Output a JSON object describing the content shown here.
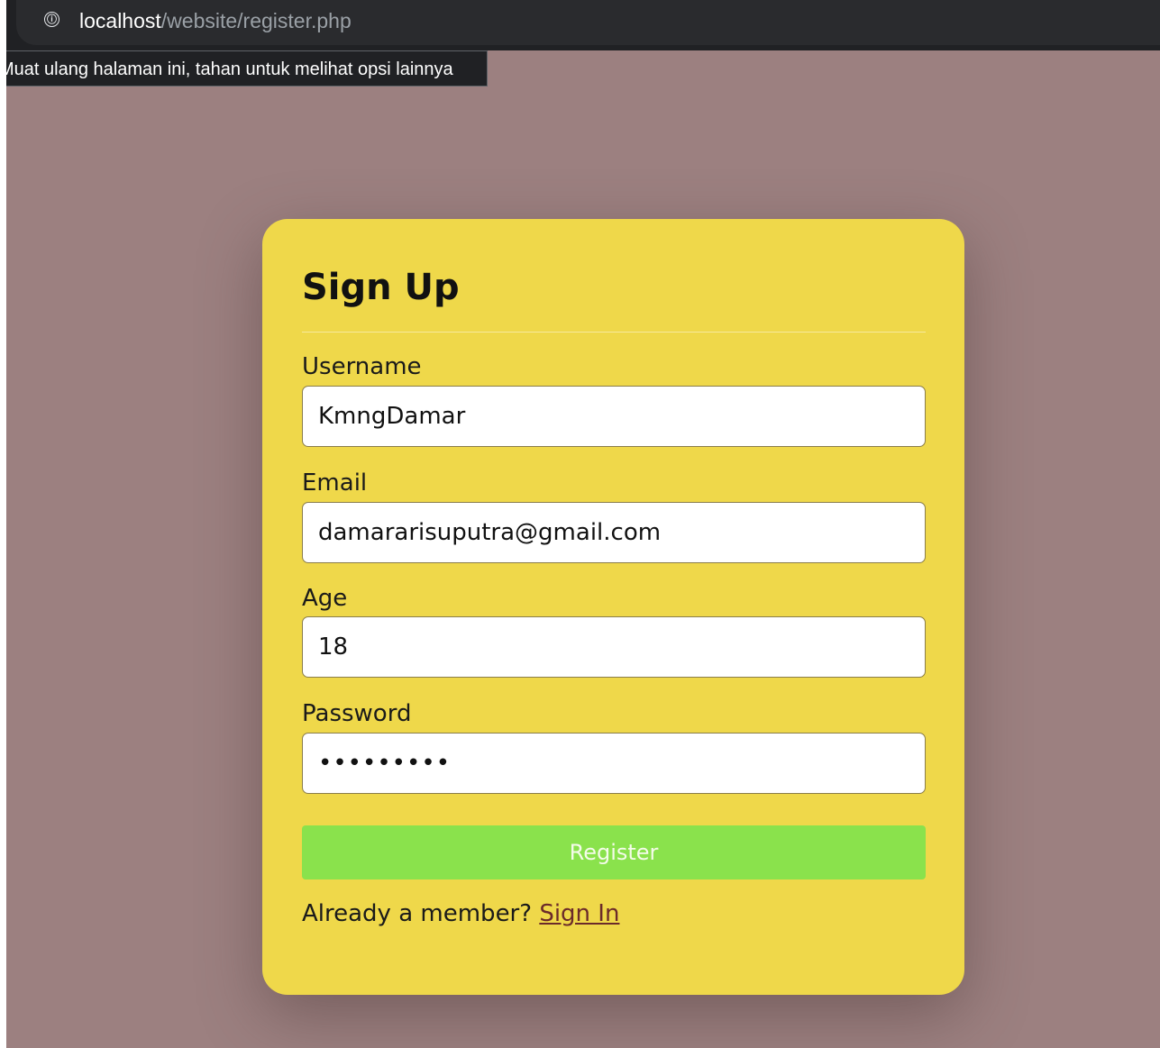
{
  "browser": {
    "url_host": "localhost",
    "url_path": "/website/register.php",
    "reload_tooltip": "Muat ulang halaman ini, tahan untuk melihat opsi lainnya",
    "site_info_icon": "ⓘ"
  },
  "form": {
    "title": "Sign Up",
    "fields": [
      {
        "label": "Username",
        "value": "KmngDamar",
        "type": "text"
      },
      {
        "label": "Email",
        "value": "damararisuputra@gmail.com",
        "type": "email"
      },
      {
        "label": "Age",
        "value": "18",
        "type": "number"
      },
      {
        "label": "Password",
        "value": "Password1",
        "type": "password"
      }
    ],
    "submit_label": "Register",
    "footer_text": "Already a member? ",
    "footer_link": "Sign In"
  },
  "colors": {
    "page_background": "#9c8080",
    "card_background": "#efd84a",
    "register_button": "#8ae24c",
    "link": "#6b2a2a"
  }
}
